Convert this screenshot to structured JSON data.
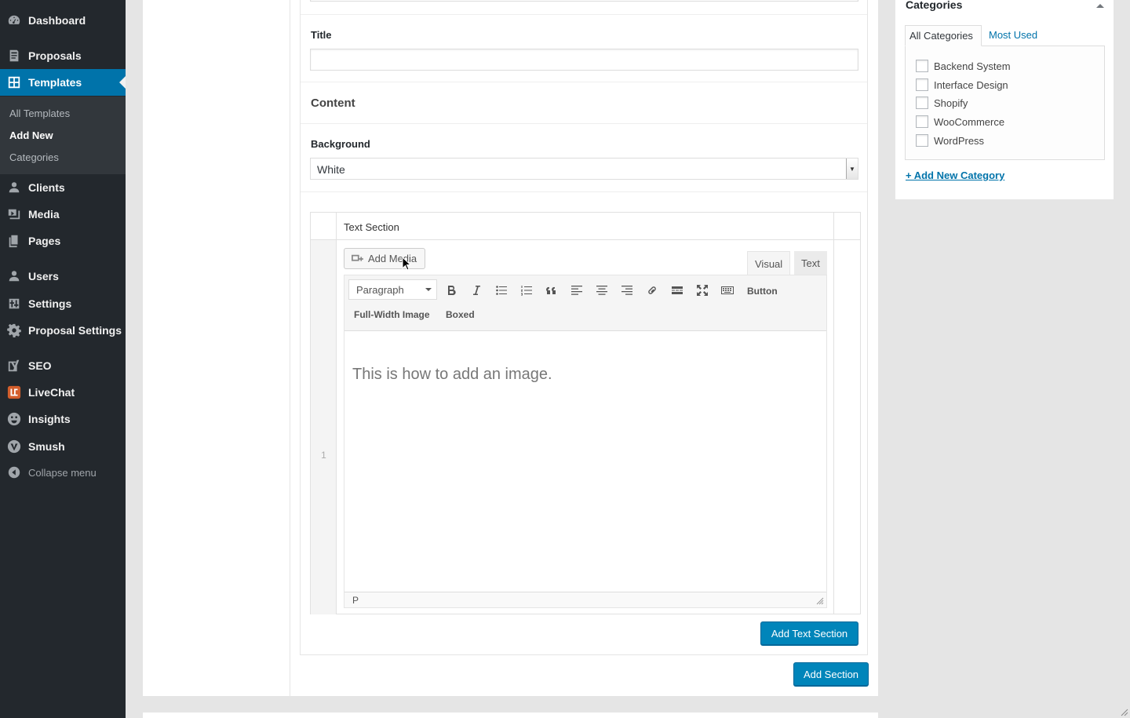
{
  "sidebar": {
    "items": [
      {
        "id": "dashboard",
        "label": "Dashboard",
        "icon": "dashboard-icon"
      },
      {
        "id": "proposals",
        "label": "Proposals",
        "icon": "document-icon"
      },
      {
        "id": "templates",
        "label": "Templates",
        "icon": "grid-icon"
      },
      {
        "id": "clients",
        "label": "Clients",
        "icon": "users-icon"
      },
      {
        "id": "media",
        "label": "Media",
        "icon": "media-icon"
      },
      {
        "id": "pages",
        "label": "Pages",
        "icon": "pages-icon"
      },
      {
        "id": "users",
        "label": "Users",
        "icon": "user-icon"
      },
      {
        "id": "settings",
        "label": "Settings",
        "icon": "settings-icon"
      },
      {
        "id": "proposal-settings",
        "label": "Proposal Settings",
        "icon": "gear-icon"
      },
      {
        "id": "seo",
        "label": "SEO",
        "icon": "yoast-icon"
      },
      {
        "id": "livechat",
        "label": "LiveChat",
        "icon": "livechat-icon"
      },
      {
        "id": "insights",
        "label": "Insights",
        "icon": "insights-icon"
      },
      {
        "id": "smush",
        "label": "Smush",
        "icon": "smush-icon"
      }
    ],
    "submenu": [
      "All Templates",
      "Add New",
      "Categories"
    ],
    "collapse_label": "Collapse menu"
  },
  "form": {
    "title_label": "Title",
    "title_value": "",
    "content_heading": "Content",
    "background_label": "Background",
    "background_value": "White"
  },
  "repeater": {
    "column_header": "Text Section",
    "row_number": "1",
    "add_media_label": "Add Media",
    "tab_visual": "Visual",
    "tab_text": "Text",
    "format_value": "Paragraph",
    "toolbar_button_label": "Button",
    "toolbar_row2": [
      "Full-Width Image",
      "Boxed"
    ],
    "content_text": "This is how to add an image.",
    "status_path": "P",
    "add_text_section_label": "Add Text Section"
  },
  "add_section_label": "Add Section",
  "categories": {
    "title": "Categories",
    "tab_all": "All Categories",
    "tab_most_used": "Most Used",
    "items": [
      "Backend System",
      "Interface Design",
      "Shopify",
      "WooCommerce",
      "WordPress"
    ],
    "add_new_label": "+ Add New Category"
  },
  "colors": {
    "sidebar_bg": "#23282d",
    "accent": "#0073aa",
    "primary_button": "#0085ba"
  }
}
